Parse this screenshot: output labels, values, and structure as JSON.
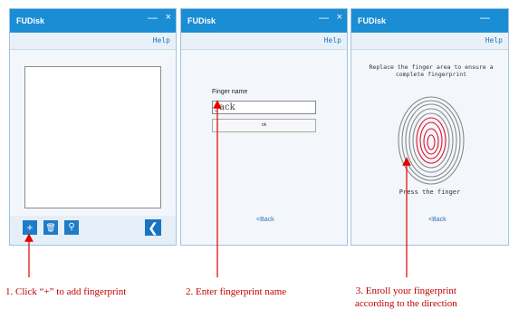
{
  "panels": [
    {
      "app_title": "FUDisk",
      "help": "Help"
    },
    {
      "app_title": "FUDisk",
      "help": "Help",
      "field_label": "Finger name",
      "field_value": "Jack",
      "ok": "ok",
      "back": "<Back"
    },
    {
      "app_title": "FUDisk",
      "help": "Help",
      "instruction": "Replace the finger area to ensure a complete fingerprint",
      "status": "Press the finger",
      "back": "<Back"
    }
  ],
  "window_controls": {
    "minimize": "—",
    "close": "×"
  },
  "toolbar_icons": [
    "add-icon",
    "delete-icon",
    "search-icon",
    "back-icon"
  ],
  "captions": [
    "1.  Click “+” to add  fingerprint",
    "2.  Enter  fingerprint name",
    "3.  Enroll your fingerprint",
    "according to the direction"
  ],
  "colors": {
    "titlebar": "#1a8dd4",
    "arrow": "#e00000",
    "fingerprint_ridge": "#888888",
    "fingerprint_core": "#e0102a"
  }
}
